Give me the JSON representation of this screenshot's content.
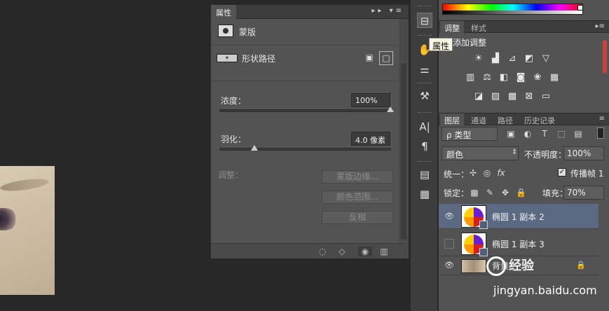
{
  "properties": {
    "tab_label": "属性",
    "mask_title": "蒙版",
    "vector_label": "形状路径",
    "density_label": "浓度：",
    "density_value": "100%",
    "density_level": 1.0,
    "feather_label": "羽化：",
    "feather_value": "4.0 像素",
    "feather_level": 0.2,
    "refine_label": "调整：",
    "btn_mask_edge": "蒙版边缘...",
    "btn_color_range": "颜色范围...",
    "btn_invert": "反相"
  },
  "tooltip": "属性",
  "adjustments": {
    "tabs": [
      "调整",
      "样式"
    ],
    "add_label": "添加调整",
    "icons_row1": [
      "brightness-icon",
      "levels-icon",
      "curves-icon",
      "exposure-icon",
      "vibrance-icon"
    ],
    "icons_row2": [
      "hue-sat-icon",
      "color-balance-icon",
      "bw-icon",
      "photo-filter-icon",
      "channel-mixer-icon",
      "color-lookup-icon"
    ],
    "icons_row3": [
      "invert-icon",
      "posterize-icon",
      "threshold-icon",
      "selective-color-icon",
      "gradient-map-icon"
    ]
  },
  "layers_panel": {
    "tabs": [
      "图层",
      "通道",
      "路径",
      "历史记录"
    ],
    "filter_label": "ρ 类型",
    "blend_mode": "颜色",
    "opacity_label": "不透明度：",
    "opacity_value": "100%",
    "unify_label": "统一：",
    "propagate_label": "传播帧 1",
    "lock_label": "锁定：",
    "fill_label": "填充：",
    "fill_value": "70%",
    "layers": [
      {
        "name": "椭圆 1 副本 2",
        "visible": true,
        "selected": true
      },
      {
        "name": "椭圆 1 副本 3",
        "visible": false,
        "selected": false
      },
      {
        "name": "背景",
        "visible": true,
        "selected": false
      }
    ]
  },
  "watermark": {
    "text": "经验",
    "url": "jingyan.baidu.com"
  }
}
